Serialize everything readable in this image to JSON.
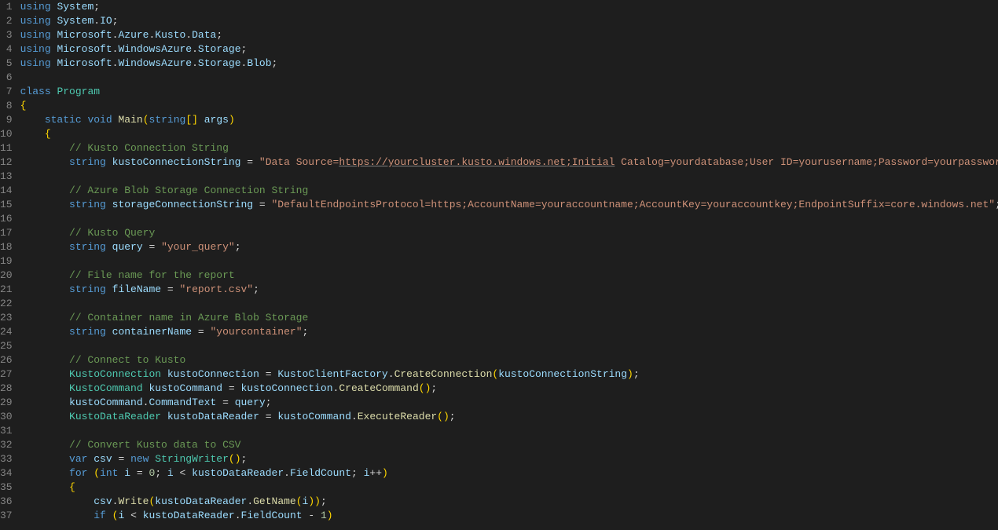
{
  "total_lines": 37,
  "code": {
    "l1": [
      [
        "kw",
        "using"
      ],
      [
        "punc",
        " "
      ],
      [
        "var",
        "System"
      ],
      [
        "punc",
        ";"
      ]
    ],
    "l2": [
      [
        "kw",
        "using"
      ],
      [
        "punc",
        " "
      ],
      [
        "var",
        "System"
      ],
      [
        "punc",
        "."
      ],
      [
        "var",
        "IO"
      ],
      [
        "punc",
        ";"
      ]
    ],
    "l3": [
      [
        "kw",
        "using"
      ],
      [
        "punc",
        " "
      ],
      [
        "var",
        "Microsoft"
      ],
      [
        "punc",
        "."
      ],
      [
        "var",
        "Azure"
      ],
      [
        "punc",
        "."
      ],
      [
        "var",
        "Kusto"
      ],
      [
        "punc",
        "."
      ],
      [
        "var",
        "Data"
      ],
      [
        "punc",
        ";"
      ]
    ],
    "l4": [
      [
        "kw",
        "using"
      ],
      [
        "punc",
        " "
      ],
      [
        "var",
        "Microsoft"
      ],
      [
        "punc",
        "."
      ],
      [
        "var",
        "WindowsAzure"
      ],
      [
        "punc",
        "."
      ],
      [
        "var",
        "Storage"
      ],
      [
        "punc",
        ";"
      ]
    ],
    "l5": [
      [
        "kw",
        "using"
      ],
      [
        "punc",
        " "
      ],
      [
        "var",
        "Microsoft"
      ],
      [
        "punc",
        "."
      ],
      [
        "var",
        "WindowsAzure"
      ],
      [
        "punc",
        "."
      ],
      [
        "var",
        "Storage"
      ],
      [
        "punc",
        "."
      ],
      [
        "var",
        "Blob"
      ],
      [
        "punc",
        ";"
      ]
    ],
    "l6": [],
    "l7": [
      [
        "kw",
        "class"
      ],
      [
        "punc",
        " "
      ],
      [
        "cls",
        "Program"
      ]
    ],
    "l8": [
      [
        "br",
        "{"
      ]
    ],
    "l9": [
      [
        "punc",
        "    "
      ],
      [
        "kw",
        "static"
      ],
      [
        "punc",
        " "
      ],
      [
        "kw",
        "void"
      ],
      [
        "punc",
        " "
      ],
      [
        "mtd",
        "Main"
      ],
      [
        "br",
        "("
      ],
      [
        "kw",
        "string"
      ],
      [
        "br",
        "[]"
      ],
      [
        "punc",
        " "
      ],
      [
        "var",
        "args"
      ],
      [
        "br",
        ")"
      ]
    ],
    "l10": [
      [
        "punc",
        "    "
      ],
      [
        "br",
        "{"
      ]
    ],
    "l11": [
      [
        "punc",
        "        "
      ],
      [
        "cmt",
        "// Kusto Connection String"
      ]
    ],
    "l12": [
      [
        "punc",
        "        "
      ],
      [
        "kw",
        "string"
      ],
      [
        "punc",
        " "
      ],
      [
        "var",
        "kustoConnectionString"
      ],
      [
        "punc",
        " = "
      ],
      [
        "str",
        "\"Data Source="
      ],
      [
        "str ul",
        "https://yourcluster.kusto.windows.net;Initial"
      ],
      [
        "str",
        " Catalog=yourdatabase;User ID=yourusername;Password=yourpassword;\""
      ],
      [
        "punc",
        ";"
      ]
    ],
    "l13": [],
    "l14": [
      [
        "punc",
        "        "
      ],
      [
        "cmt",
        "// Azure Blob Storage Connection String"
      ]
    ],
    "l15": [
      [
        "punc",
        "        "
      ],
      [
        "kw",
        "string"
      ],
      [
        "punc",
        " "
      ],
      [
        "var",
        "storageConnectionString"
      ],
      [
        "punc",
        " = "
      ],
      [
        "str",
        "\"DefaultEndpointsProtocol=https;AccountName=youraccountname;AccountKey=youraccountkey;EndpointSuffix=core.windows.net\""
      ],
      [
        "punc",
        ";"
      ]
    ],
    "l16": [],
    "l17": [
      [
        "punc",
        "        "
      ],
      [
        "cmt",
        "// Kusto Query"
      ]
    ],
    "l18": [
      [
        "punc",
        "        "
      ],
      [
        "kw",
        "string"
      ],
      [
        "punc",
        " "
      ],
      [
        "var",
        "query"
      ],
      [
        "punc",
        " = "
      ],
      [
        "str",
        "\"your_query\""
      ],
      [
        "punc",
        ";"
      ]
    ],
    "l19": [],
    "l20": [
      [
        "punc",
        "        "
      ],
      [
        "cmt",
        "// File name for the report"
      ]
    ],
    "l21": [
      [
        "punc",
        "        "
      ],
      [
        "kw",
        "string"
      ],
      [
        "punc",
        " "
      ],
      [
        "var",
        "fileName"
      ],
      [
        "punc",
        " = "
      ],
      [
        "str",
        "\"report.csv\""
      ],
      [
        "punc",
        ";"
      ]
    ],
    "l22": [],
    "l23": [
      [
        "punc",
        "        "
      ],
      [
        "cmt",
        "// Container name in Azure Blob Storage"
      ]
    ],
    "l24": [
      [
        "punc",
        "        "
      ],
      [
        "kw",
        "string"
      ],
      [
        "punc",
        " "
      ],
      [
        "var",
        "containerName"
      ],
      [
        "punc",
        " = "
      ],
      [
        "str",
        "\"yourcontainer\""
      ],
      [
        "punc",
        ";"
      ]
    ],
    "l25": [],
    "l26": [
      [
        "punc",
        "        "
      ],
      [
        "cmt",
        "// Connect to Kusto"
      ]
    ],
    "l27": [
      [
        "punc",
        "        "
      ],
      [
        "cls",
        "KustoConnection"
      ],
      [
        "punc",
        " "
      ],
      [
        "var",
        "kustoConnection"
      ],
      [
        "punc",
        " = "
      ],
      [
        "var",
        "KustoClientFactory"
      ],
      [
        "punc",
        "."
      ],
      [
        "mtd",
        "CreateConnection"
      ],
      [
        "br",
        "("
      ],
      [
        "var",
        "kustoConnectionString"
      ],
      [
        "br",
        ")"
      ],
      [
        "punc",
        ";"
      ]
    ],
    "l28": [
      [
        "punc",
        "        "
      ],
      [
        "cls",
        "KustoCommand"
      ],
      [
        "punc",
        " "
      ],
      [
        "var",
        "kustoCommand"
      ],
      [
        "punc",
        " = "
      ],
      [
        "var",
        "kustoConnection"
      ],
      [
        "punc",
        "."
      ],
      [
        "mtd",
        "CreateCommand"
      ],
      [
        "br",
        "()"
      ],
      [
        "punc",
        ";"
      ]
    ],
    "l29": [
      [
        "punc",
        "        "
      ],
      [
        "var",
        "kustoCommand"
      ],
      [
        "punc",
        "."
      ],
      [
        "var",
        "CommandText"
      ],
      [
        "punc",
        " = "
      ],
      [
        "var",
        "query"
      ],
      [
        "punc",
        ";"
      ]
    ],
    "l30": [
      [
        "punc",
        "        "
      ],
      [
        "cls",
        "KustoDataReader"
      ],
      [
        "punc",
        " "
      ],
      [
        "var",
        "kustoDataReader"
      ],
      [
        "punc",
        " = "
      ],
      [
        "var",
        "kustoCommand"
      ],
      [
        "punc",
        "."
      ],
      [
        "mtd",
        "ExecuteReader"
      ],
      [
        "br",
        "()"
      ],
      [
        "punc",
        ";"
      ]
    ],
    "l31": [],
    "l32": [
      [
        "punc",
        "        "
      ],
      [
        "cmt",
        "// Convert Kusto data to CSV"
      ]
    ],
    "l33": [
      [
        "punc",
        "        "
      ],
      [
        "kw",
        "var"
      ],
      [
        "punc",
        " "
      ],
      [
        "var",
        "csv"
      ],
      [
        "punc",
        " = "
      ],
      [
        "kw",
        "new"
      ],
      [
        "punc",
        " "
      ],
      [
        "cls",
        "StringWriter"
      ],
      [
        "br",
        "()"
      ],
      [
        "punc",
        ";"
      ]
    ],
    "l34": [
      [
        "punc",
        "        "
      ],
      [
        "kw",
        "for"
      ],
      [
        "punc",
        " "
      ],
      [
        "br",
        "("
      ],
      [
        "kw",
        "int"
      ],
      [
        "punc",
        " "
      ],
      [
        "var",
        "i"
      ],
      [
        "punc",
        " = "
      ],
      [
        "num2",
        "0"
      ],
      [
        "punc",
        "; "
      ],
      [
        "var",
        "i"
      ],
      [
        "punc",
        " < "
      ],
      [
        "var",
        "kustoDataReader"
      ],
      [
        "punc",
        "."
      ],
      [
        "var",
        "FieldCount"
      ],
      [
        "punc",
        "; "
      ],
      [
        "var",
        "i"
      ],
      [
        "punc",
        "++"
      ],
      [
        "br",
        ")"
      ]
    ],
    "l35": [
      [
        "punc",
        "        "
      ],
      [
        "br",
        "{"
      ]
    ],
    "l36": [
      [
        "punc",
        "            "
      ],
      [
        "var",
        "csv"
      ],
      [
        "punc",
        "."
      ],
      [
        "mtd",
        "Write"
      ],
      [
        "br",
        "("
      ],
      [
        "var",
        "kustoDataReader"
      ],
      [
        "punc",
        "."
      ],
      [
        "mtd",
        "GetName"
      ],
      [
        "br",
        "("
      ],
      [
        "var",
        "i"
      ],
      [
        "br",
        "))"
      ],
      [
        "punc",
        ";"
      ]
    ],
    "l37": [
      [
        "punc",
        "            "
      ],
      [
        "kw",
        "if"
      ],
      [
        "punc",
        " "
      ],
      [
        "br",
        "("
      ],
      [
        "var",
        "i"
      ],
      [
        "punc",
        " < "
      ],
      [
        "var",
        "kustoDataReader"
      ],
      [
        "punc",
        "."
      ],
      [
        "var",
        "FieldCount"
      ],
      [
        "punc",
        " - "
      ],
      [
        "num2",
        "1"
      ],
      [
        "br",
        ")"
      ]
    ]
  }
}
